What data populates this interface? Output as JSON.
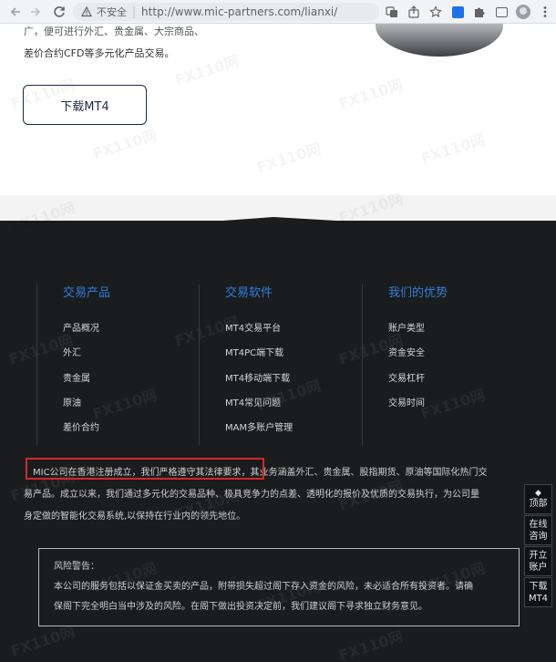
{
  "browser": {
    "back_icon": "arrow-left-icon",
    "forward_icon": "arrow-right-icon",
    "reload_icon": "reload-icon",
    "insecure_label": "不安全",
    "url": "http://www.mic-partners.com/lianxi/"
  },
  "intro": {
    "line1": "广，便可进行外汇、贵金属、大宗商品、",
    "line2": "差价合约CFD等多元化产品交易。"
  },
  "download_button": "下载MT4",
  "columns": [
    {
      "title": "交易产品",
      "items": [
        "产品概况",
        "外汇",
        "贵金属",
        "原油",
        "差价合约"
      ]
    },
    {
      "title": "交易软件",
      "items": [
        "MT4交易平台",
        "MT4PC端下载",
        "MT4移动端下载",
        "MT4常见问题",
        "MAM多账户管理"
      ]
    },
    {
      "title": "我们的优势",
      "items": [
        "账户类型",
        "资金安全",
        "交易杠杆",
        "交易时间"
      ]
    }
  ],
  "about": {
    "line1": "MIC公司在香港注册成立，我们严格遵守其法律要求，其业务涵盖外汇、贵金属、股指期货、原油等国际化热门交",
    "line2": "易产品。成立以来，我们通过多元化的交易品种、极具竞争力的点差、透明化的报价及优质的交易执行，为公司量",
    "line3": "身定做的智能化交易系统,以保持在行业内的领先地位。"
  },
  "risk": {
    "title": "风险警告：",
    "line1": "本公司的服务包括以保证金买卖的产品，附带损失超过阁下存入资金的风险，未必适合所有投资者。请确",
    "line2": "保阁下完全明白当中涉及的风险。在阁下做出投资决定前，我们建议阁下寻求独立财务意见。"
  },
  "float_buttons": {
    "top_arrow": "◆",
    "top": "顶部",
    "consult_1": "在线",
    "consult_2": "咨询",
    "open_1": "开立",
    "open_2": "账户",
    "download_1": "下载",
    "download_2": "MT4"
  },
  "watermark": "FX110网",
  "colors": {
    "footer_bg": "#1b1c1e",
    "accent_blue": "#2f7fd9",
    "highlight_red": "#cf2a2a",
    "button_border": "#1c2b4a"
  }
}
